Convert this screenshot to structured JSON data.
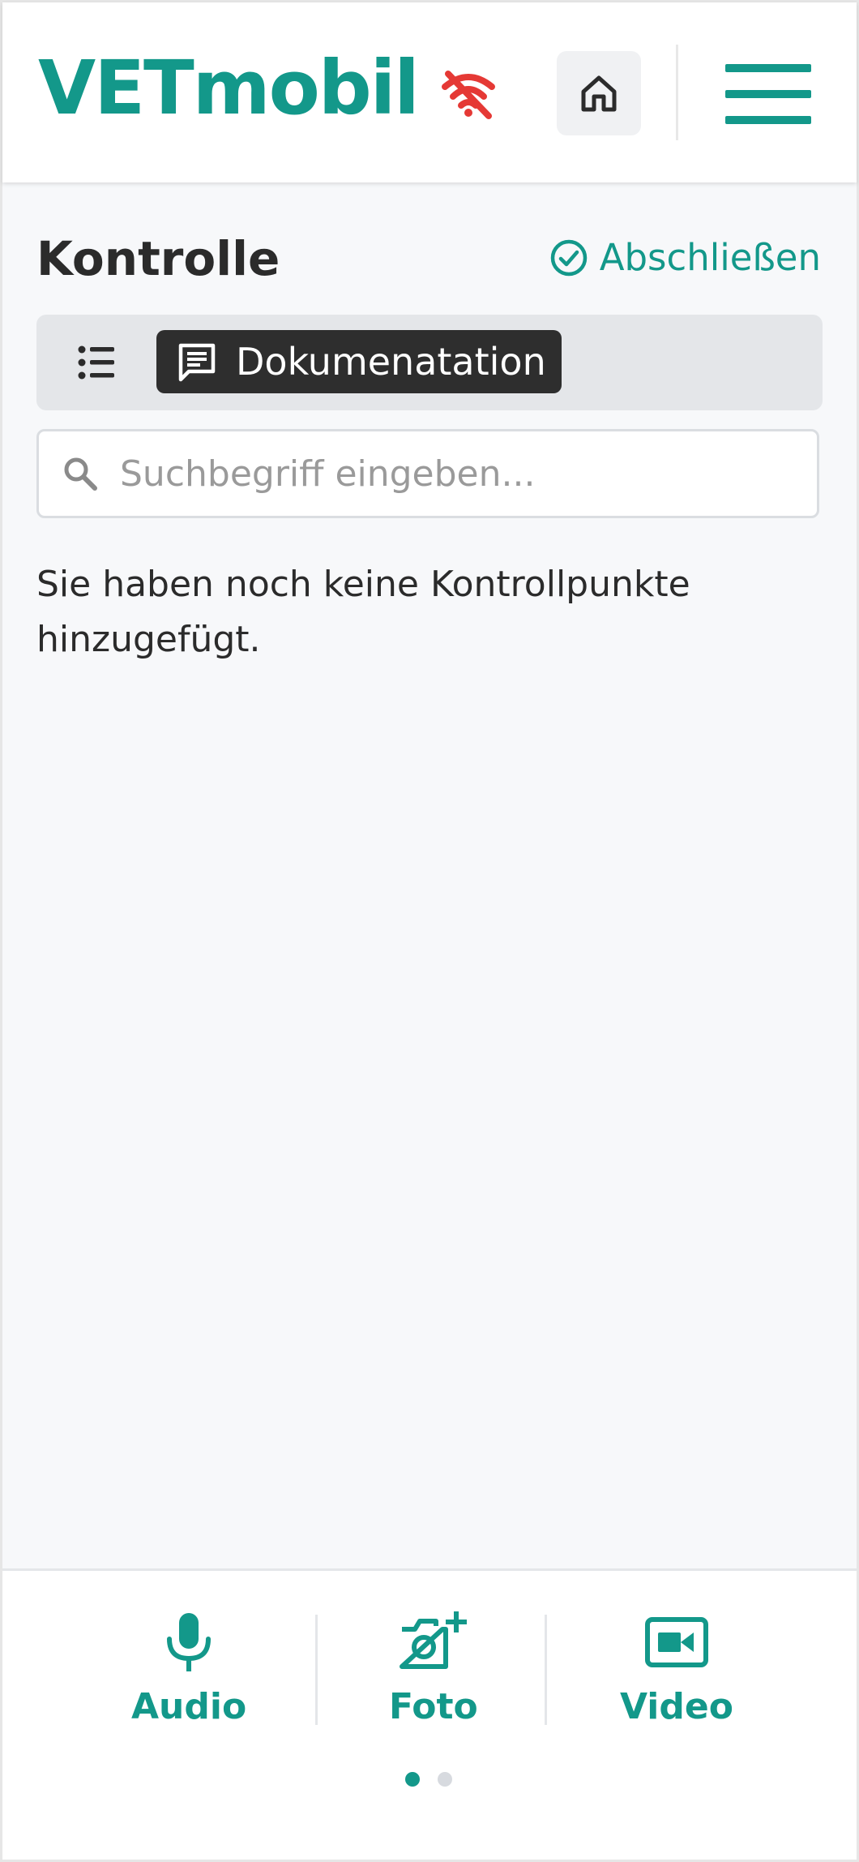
{
  "header": {
    "brand": "VETmobil",
    "offline_icon": "wifi-off-icon",
    "home_icon": "home-icon",
    "menu_icon": "hamburger-menu-icon"
  },
  "main": {
    "title": "Kontrolle",
    "finish_label": "Abschließen",
    "segments": {
      "list_icon": "list-icon",
      "active_label": "Dokumenatation",
      "active_icon": "comment-icon"
    },
    "search": {
      "placeholder": "Suchbegriff eingeben...",
      "value": ""
    },
    "empty_message": "Sie haben noch keine Kontrollpunkte hinzugefügt."
  },
  "bottom": {
    "tools": [
      {
        "label": "Audio",
        "icon": "microphone-icon"
      },
      {
        "label": "Foto",
        "icon": "camera-plus-icon"
      },
      {
        "label": "Video",
        "icon": "video-camera-icon"
      }
    ],
    "page_indicator": {
      "current": 1,
      "total": 2
    }
  },
  "colors": {
    "accent": "#13988a",
    "offline": "#e53935",
    "dark": "#2e2e2e",
    "background": "#f7f8fa"
  }
}
